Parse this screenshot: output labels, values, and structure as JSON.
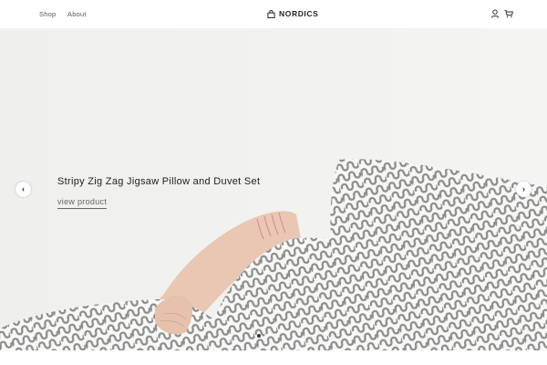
{
  "header": {
    "nav": [
      {
        "label": "Shop",
        "icon": "none"
      },
      {
        "label": "About",
        "icon": "none"
      }
    ],
    "brand": {
      "label": "NORDICS",
      "icon": "bag-icon"
    },
    "actions": [
      {
        "icon": "user-icon"
      },
      {
        "icon": "cart-icon"
      }
    ]
  },
  "hero": {
    "title": "Stripy Zig Zag Jigsaw Pillow and Duvet Set",
    "link_label": "view product",
    "prev_glyph": "‹",
    "next_glyph": "›",
    "slides_total": 2,
    "active_slide": 1
  },
  "colors": {
    "background": "#f1f1ef",
    "text": "#222222",
    "pattern": "#8c8c8c"
  }
}
